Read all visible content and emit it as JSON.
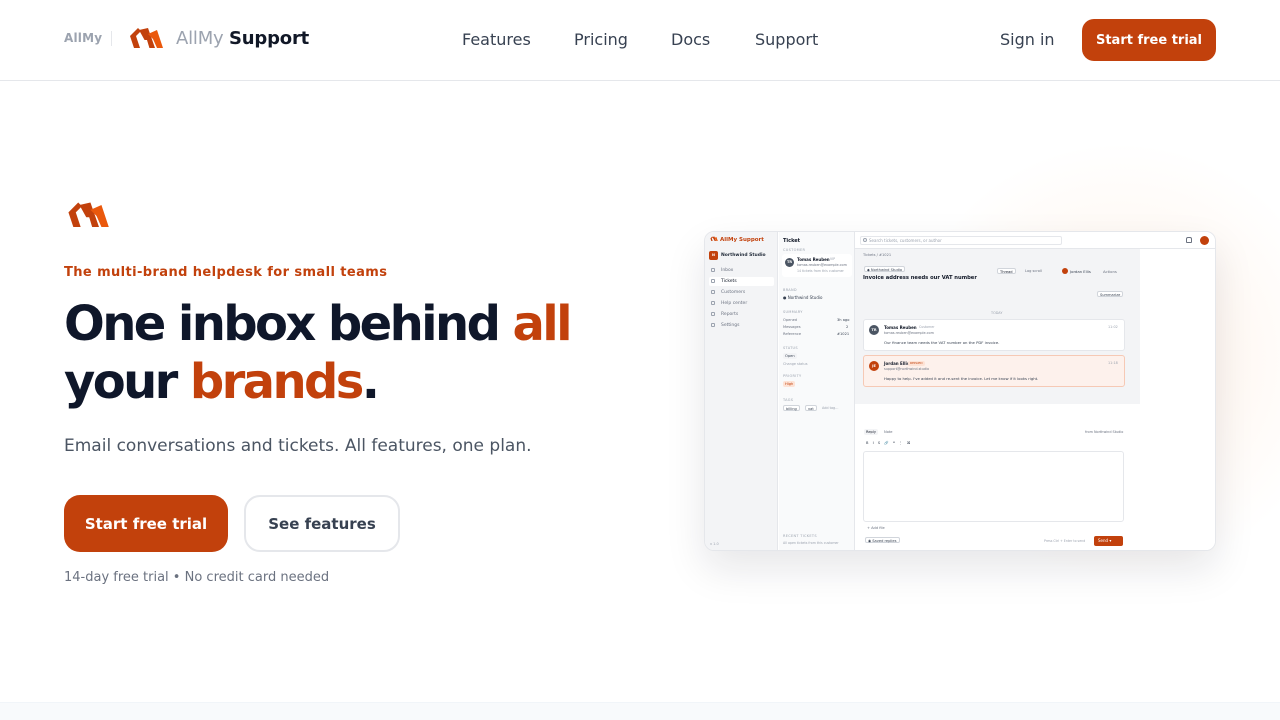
{
  "header": {
    "brand_small": "AllMy",
    "brand_name_light": "AllMy",
    "brand_name_bold": "Support",
    "nav": [
      "Features",
      "Pricing",
      "Docs",
      "Support"
    ],
    "signin": "Sign in",
    "cta": "Start free trial"
  },
  "hero": {
    "eyebrow": "The multi-brand helpdesk for small teams",
    "headline_part1": "One inbox behind ",
    "headline_accent1": "all",
    "headline_part2": "your ",
    "headline_accent2": "brands",
    "headline_end": ".",
    "subhead": "Email conversations and tickets. All features, one plan.",
    "primary_cta": "Start free trial",
    "secondary_cta": "See features",
    "fineprint": "14-day free trial • No credit card needed"
  },
  "colors": {
    "accent": "#c2410c",
    "heading": "#0f172a",
    "body": "#4b5563"
  },
  "preview": {
    "app_name": "AllMy Support",
    "org": "Northwind Studio",
    "org_initial": "N",
    "nav": [
      "Inbox",
      "Tickets",
      "Customers",
      "Help center",
      "Reports",
      "Settings"
    ],
    "version": "v 1.0",
    "detail_title": "Ticket",
    "section_customer": "CUSTOMER",
    "customer_initials": "TR",
    "customer_name": "Tomas Reuben",
    "customer_tag": "VIP",
    "customer_email": "tomas.reuben@example.com",
    "customer_note": "14 tickets from this customer",
    "section_brand": "BRAND",
    "brand": "Northwind Studio",
    "section_summary": "SUMMARY",
    "summary_rows": [
      {
        "k": "Opened",
        "v": "3h ago"
      },
      {
        "k": "Messages",
        "v": "2"
      },
      {
        "k": "Reference",
        "v": "#1021"
      }
    ],
    "section_status": "STATUS",
    "status": "Open",
    "status_note": "Change status",
    "section_priority": "PRIORITY",
    "priority": "High",
    "section_tags": "TAGS",
    "tags": [
      "billing",
      "vat"
    ],
    "tag_placeholder": "Add tag...",
    "recent": "RECENT TICKETS",
    "recent_note": "All open tickets from this customer",
    "search_placeholder": "Search tickets, customers, or author",
    "breadcrumb": "Tickets / #1021",
    "brand_chip": "Northwind Studio",
    "ticket_subject": "Invoice address needs our VAT number",
    "view_tabs": [
      "Thread",
      "Log scroll"
    ],
    "assignee": "Jordan Ellis",
    "actions": "Actions",
    "summarize": "Summarize",
    "today": "TODAY",
    "messages": [
      {
        "initials": "TR",
        "name": "Tomas Reuben",
        "tag": "Customer",
        "email": "tomas.reuben@example.com",
        "time": "11:02",
        "body": "Our finance team needs the VAT number on the PDF invoice."
      },
      {
        "initials": "JE",
        "name": "Jordan Ellis",
        "tag": "REPLIED",
        "email": "support@northwind.studio",
        "time": "11:18",
        "body": "Happy to help. I've added it and re-sent the invoice. Let me know if it looks right."
      }
    ],
    "reply_tabs": [
      "Reply",
      "Note"
    ],
    "reply_from": "from Northwind Studio",
    "toolbar": [
      "B",
      "I",
      "S",
      "🔗",
      "❝",
      "⋮",
      "⌘"
    ],
    "add_file": "Add file",
    "saved_replies": "Saved replies",
    "send_hint": "Press Ctrl + Enter to send",
    "send": "Send"
  }
}
